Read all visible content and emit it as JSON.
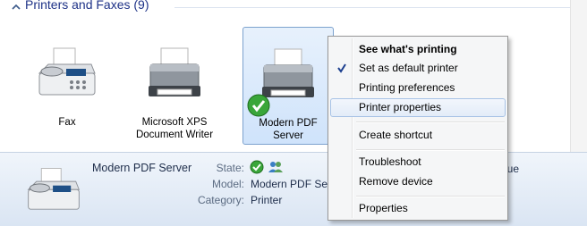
{
  "group": {
    "title": "Printers and Faxes (9)"
  },
  "devices": [
    {
      "label_line1": "Fax",
      "label_line2": ""
    },
    {
      "label_line1": "Microsoft XPS",
      "label_line2": "Document Writer"
    },
    {
      "label_line1": "Modern PDF",
      "label_line2": "Server"
    }
  ],
  "details": {
    "name": "Modern PDF Server",
    "state_label": "State:",
    "model_label": "Model:",
    "model_value": "Modern PDF Ser",
    "category_label": "Category:",
    "category_value": "Printer",
    "partial_text": "eue"
  },
  "context_menu": {
    "items": [
      {
        "label": "See what's printing",
        "bold": true
      },
      {
        "label": "Set as default printer",
        "checked": true
      },
      {
        "label": "Printing preferences"
      },
      {
        "label": "Printer properties",
        "hover": true
      },
      {
        "label": "Create shortcut"
      },
      {
        "label": "Troubleshoot"
      },
      {
        "label": "Remove device"
      },
      {
        "label": "Properties"
      }
    ]
  },
  "icons": [
    "chevron-up-icon",
    "fax-icon",
    "printer-icon",
    "default-check-icon",
    "checkmark-icon",
    "users-icon"
  ],
  "colors": {
    "group_title": "#1e3287",
    "selection_border": "#7da2ce",
    "menu_hover": "#e3ecf8"
  }
}
